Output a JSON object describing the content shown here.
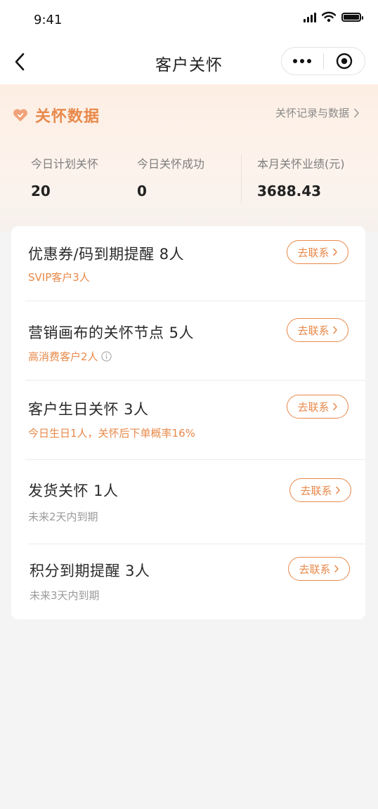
{
  "status_bar": {
    "time": "9:41"
  },
  "nav": {
    "title": "客户关怀"
  },
  "care": {
    "title": "关怀数据",
    "link_label": "关怀记录与数据",
    "stats": [
      {
        "label": "今日计划关怀",
        "value": "20"
      },
      {
        "label": "今日关怀成功",
        "value": "0"
      },
      {
        "label": "本月关怀业绩(元)",
        "value": "3688.43"
      }
    ]
  },
  "rows": [
    {
      "title": "优惠券/码到期提醒 8人",
      "subtitle": "SVIP客户3人",
      "action": "去联系"
    },
    {
      "title": "营销画布的关怀节点 5人",
      "subtitle": "高消费客户2人",
      "action": "去联系"
    },
    {
      "title": "客户生日关怀 3人",
      "subtitle": "今日生日1人，关怀后下单概率16%",
      "action": "去联系"
    },
    {
      "title": "发货关怀 1人",
      "subtitle": "未来2天内到期",
      "action": "去联系"
    },
    {
      "title": "积分到期提醒 3人",
      "subtitle": "未来3天内到期",
      "action": "去联系"
    }
  ],
  "colors": {
    "accent": "#e8894a",
    "background": "#f4f4f4"
  }
}
